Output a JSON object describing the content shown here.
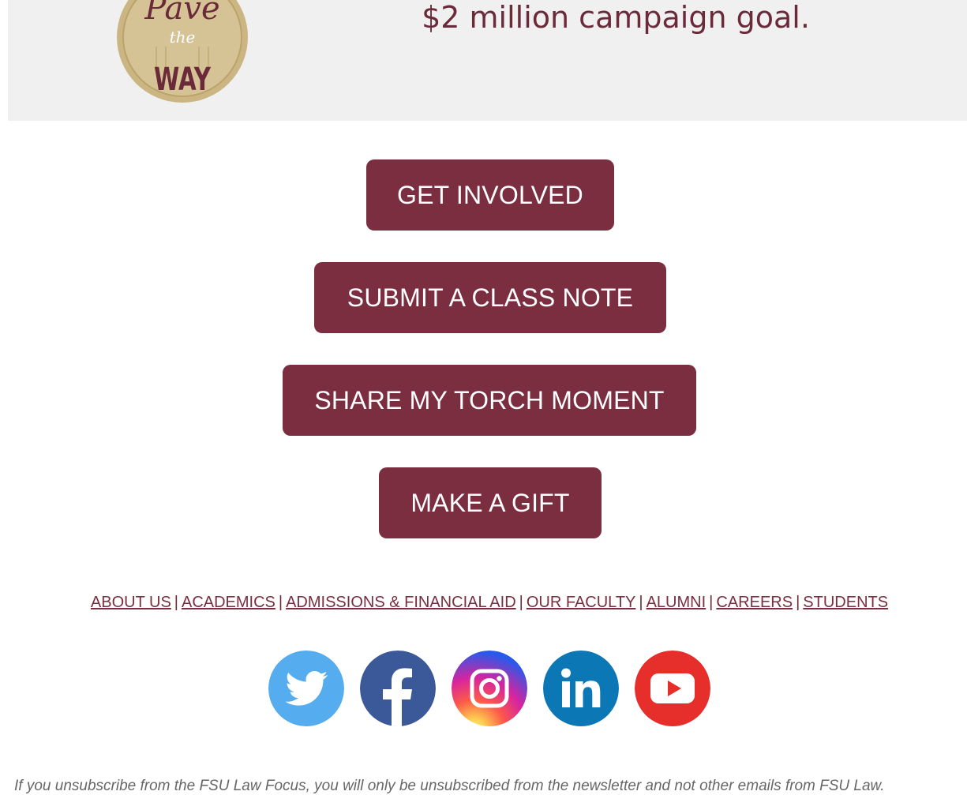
{
  "banner": {
    "headline": "$2 million campaign goal.",
    "logo": {
      "top_word": "Pave",
      "mid_word": "the",
      "bottom_word": "WAY"
    }
  },
  "buttons": [
    {
      "label": "GET INVOLVED"
    },
    {
      "label": "SUBMIT A CLASS NOTE"
    },
    {
      "label": "SHARE MY TORCH MOMENT"
    },
    {
      "label": "MAKE A GIFT"
    }
  ],
  "nav": {
    "separator": "|",
    "links": [
      {
        "label": "ABOUT US"
      },
      {
        "label": "ACADEMICS"
      },
      {
        "label": "ADMISSIONS & FINANCIAL AID"
      },
      {
        "label": "OUR FACULTY"
      },
      {
        "label": "ALUMNI"
      },
      {
        "label": "CAREERS"
      },
      {
        "label": "STUDENTS"
      }
    ]
  },
  "social": [
    {
      "icon": "twitter-icon",
      "color": "#55acee"
    },
    {
      "icon": "facebook-icon",
      "color": "#3b5998"
    },
    {
      "icon": "instagram-icon",
      "color": "#c13584"
    },
    {
      "icon": "linkedin-icon",
      "color": "#0b78b5"
    },
    {
      "icon": "youtube-icon",
      "color": "#e62e2b"
    }
  ],
  "footer": {
    "note": "If you unsubscribe from the FSU Law Focus, you will only be unsubscribed from the newsletter and not other emails from FSU Law."
  },
  "colors": {
    "brand": "#7a2e40",
    "banner_bg": "#f0f0f0",
    "logo_gold": "#cbb583"
  }
}
